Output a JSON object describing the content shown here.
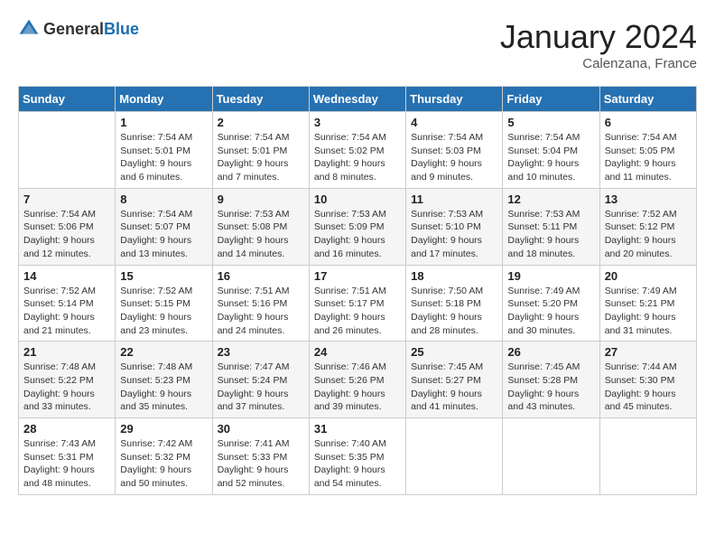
{
  "header": {
    "logo_general": "General",
    "logo_blue": "Blue",
    "month": "January 2024",
    "location": "Calenzana, France"
  },
  "weekdays": [
    "Sunday",
    "Monday",
    "Tuesday",
    "Wednesday",
    "Thursday",
    "Friday",
    "Saturday"
  ],
  "weeks": [
    [
      {
        "day": "",
        "info": ""
      },
      {
        "day": "1",
        "info": "Sunrise: 7:54 AM\nSunset: 5:01 PM\nDaylight: 9 hours\nand 6 minutes."
      },
      {
        "day": "2",
        "info": "Sunrise: 7:54 AM\nSunset: 5:01 PM\nDaylight: 9 hours\nand 7 minutes."
      },
      {
        "day": "3",
        "info": "Sunrise: 7:54 AM\nSunset: 5:02 PM\nDaylight: 9 hours\nand 8 minutes."
      },
      {
        "day": "4",
        "info": "Sunrise: 7:54 AM\nSunset: 5:03 PM\nDaylight: 9 hours\nand 9 minutes."
      },
      {
        "day": "5",
        "info": "Sunrise: 7:54 AM\nSunset: 5:04 PM\nDaylight: 9 hours\nand 10 minutes."
      },
      {
        "day": "6",
        "info": "Sunrise: 7:54 AM\nSunset: 5:05 PM\nDaylight: 9 hours\nand 11 minutes."
      }
    ],
    [
      {
        "day": "7",
        "info": "Sunrise: 7:54 AM\nSunset: 5:06 PM\nDaylight: 9 hours\nand 12 minutes."
      },
      {
        "day": "8",
        "info": "Sunrise: 7:54 AM\nSunset: 5:07 PM\nDaylight: 9 hours\nand 13 minutes."
      },
      {
        "day": "9",
        "info": "Sunrise: 7:53 AM\nSunset: 5:08 PM\nDaylight: 9 hours\nand 14 minutes."
      },
      {
        "day": "10",
        "info": "Sunrise: 7:53 AM\nSunset: 5:09 PM\nDaylight: 9 hours\nand 16 minutes."
      },
      {
        "day": "11",
        "info": "Sunrise: 7:53 AM\nSunset: 5:10 PM\nDaylight: 9 hours\nand 17 minutes."
      },
      {
        "day": "12",
        "info": "Sunrise: 7:53 AM\nSunset: 5:11 PM\nDaylight: 9 hours\nand 18 minutes."
      },
      {
        "day": "13",
        "info": "Sunrise: 7:52 AM\nSunset: 5:12 PM\nDaylight: 9 hours\nand 20 minutes."
      }
    ],
    [
      {
        "day": "14",
        "info": "Sunrise: 7:52 AM\nSunset: 5:14 PM\nDaylight: 9 hours\nand 21 minutes."
      },
      {
        "day": "15",
        "info": "Sunrise: 7:52 AM\nSunset: 5:15 PM\nDaylight: 9 hours\nand 23 minutes."
      },
      {
        "day": "16",
        "info": "Sunrise: 7:51 AM\nSunset: 5:16 PM\nDaylight: 9 hours\nand 24 minutes."
      },
      {
        "day": "17",
        "info": "Sunrise: 7:51 AM\nSunset: 5:17 PM\nDaylight: 9 hours\nand 26 minutes."
      },
      {
        "day": "18",
        "info": "Sunrise: 7:50 AM\nSunset: 5:18 PM\nDaylight: 9 hours\nand 28 minutes."
      },
      {
        "day": "19",
        "info": "Sunrise: 7:49 AM\nSunset: 5:20 PM\nDaylight: 9 hours\nand 30 minutes."
      },
      {
        "day": "20",
        "info": "Sunrise: 7:49 AM\nSunset: 5:21 PM\nDaylight: 9 hours\nand 31 minutes."
      }
    ],
    [
      {
        "day": "21",
        "info": "Sunrise: 7:48 AM\nSunset: 5:22 PM\nDaylight: 9 hours\nand 33 minutes."
      },
      {
        "day": "22",
        "info": "Sunrise: 7:48 AM\nSunset: 5:23 PM\nDaylight: 9 hours\nand 35 minutes."
      },
      {
        "day": "23",
        "info": "Sunrise: 7:47 AM\nSunset: 5:24 PM\nDaylight: 9 hours\nand 37 minutes."
      },
      {
        "day": "24",
        "info": "Sunrise: 7:46 AM\nSunset: 5:26 PM\nDaylight: 9 hours\nand 39 minutes."
      },
      {
        "day": "25",
        "info": "Sunrise: 7:45 AM\nSunset: 5:27 PM\nDaylight: 9 hours\nand 41 minutes."
      },
      {
        "day": "26",
        "info": "Sunrise: 7:45 AM\nSunset: 5:28 PM\nDaylight: 9 hours\nand 43 minutes."
      },
      {
        "day": "27",
        "info": "Sunrise: 7:44 AM\nSunset: 5:30 PM\nDaylight: 9 hours\nand 45 minutes."
      }
    ],
    [
      {
        "day": "28",
        "info": "Sunrise: 7:43 AM\nSunset: 5:31 PM\nDaylight: 9 hours\nand 48 minutes."
      },
      {
        "day": "29",
        "info": "Sunrise: 7:42 AM\nSunset: 5:32 PM\nDaylight: 9 hours\nand 50 minutes."
      },
      {
        "day": "30",
        "info": "Sunrise: 7:41 AM\nSunset: 5:33 PM\nDaylight: 9 hours\nand 52 minutes."
      },
      {
        "day": "31",
        "info": "Sunrise: 7:40 AM\nSunset: 5:35 PM\nDaylight: 9 hours\nand 54 minutes."
      },
      {
        "day": "",
        "info": ""
      },
      {
        "day": "",
        "info": ""
      },
      {
        "day": "",
        "info": ""
      }
    ]
  ]
}
